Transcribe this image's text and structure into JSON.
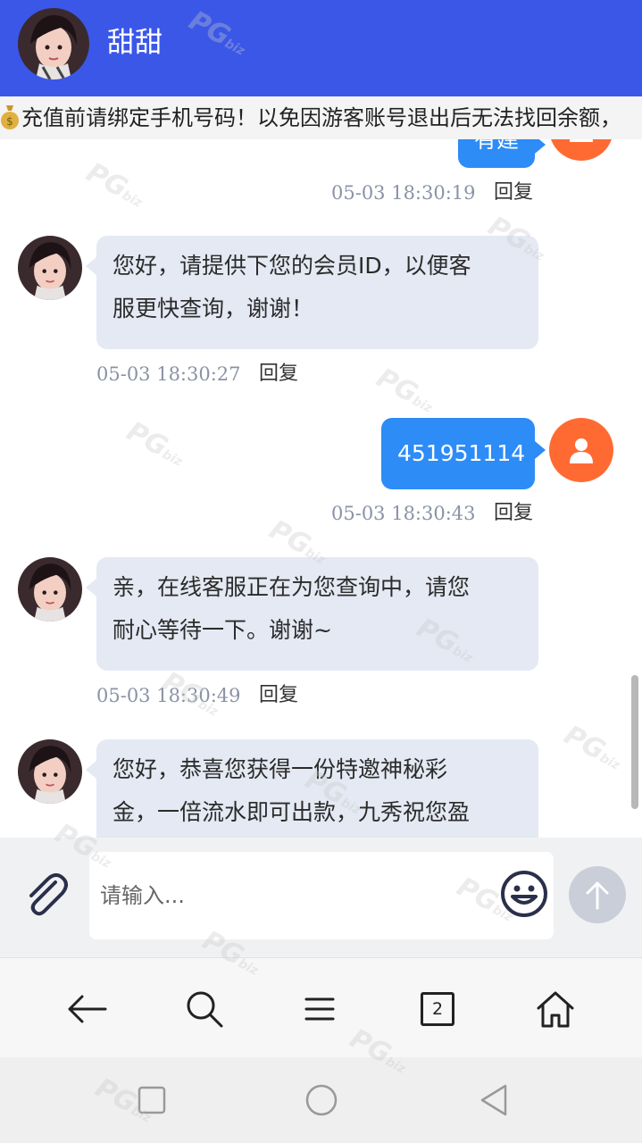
{
  "header": {
    "title": "甜甜"
  },
  "notice": {
    "text": "充值前请绑定手机号码！以免因游客账号退出后无法找回余额，"
  },
  "messages": [
    {
      "side": "right",
      "text": "有建",
      "time": "05-03 18:30:19",
      "reply": "回复"
    },
    {
      "side": "left",
      "lines": [
        "您好，请提供下您的会员ID，以便客",
        "服更快查询，谢谢！"
      ],
      "time": "05-03 18:30:27",
      "reply": "回复"
    },
    {
      "side": "right",
      "text": "451951114",
      "time": "05-03 18:30:43",
      "reply": "回复"
    },
    {
      "side": "left",
      "lines": [
        "亲，在线客服正在为您查询中，请您",
        "耐心等待一下。谢谢~"
      ],
      "time": "05-03 18:30:49",
      "reply": "回复"
    },
    {
      "side": "left",
      "lines": [
        "您好，恭喜您获得一份特邀神秘彩",
        "金，一倍流水即可出款，九秀祝您盈"
      ]
    }
  ],
  "input": {
    "placeholder": "请输入..."
  },
  "toolbar": {
    "tab_count": "2"
  },
  "watermark": {
    "text": "PG",
    "sub": "biz"
  },
  "colors": {
    "header": "#3b57e8",
    "bubble_right": "#2d8cf6",
    "bubble_left": "#e4e9f3",
    "user_avatar": "#ff6a33"
  }
}
